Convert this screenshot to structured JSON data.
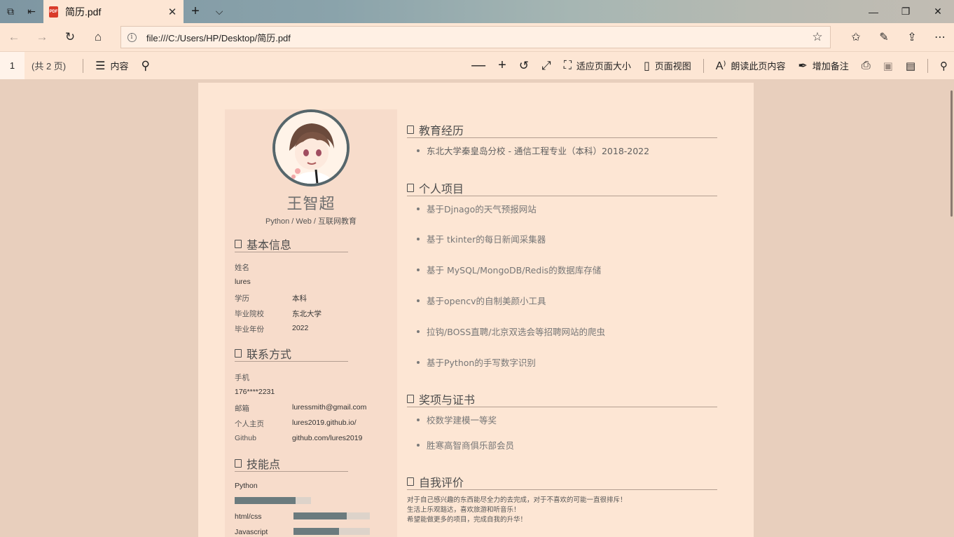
{
  "browser": {
    "tab_title": "简历.pdf",
    "tab_icon_label": "PDF",
    "address": "file:///C:/Users/HP/Desktop/简历.pdf"
  },
  "pdf_toolbar": {
    "page_current": "1",
    "page_total": "(共 2 页)",
    "contents_label": "内容",
    "fit_page_label": "适应页面大小",
    "page_view_label": "页面视图",
    "read_aloud_label": "朗读此页内容",
    "add_note_label": "增加备注"
  },
  "resume": {
    "name": "王智超",
    "subtitle": "Python / Web / 互联网教育",
    "basic_info": {
      "title": "基本信息",
      "name_label": "姓名",
      "name_value": "lures",
      "edu_label": "学历",
      "edu_value": "本科",
      "school_label": "毕业院校",
      "school_value": "东北大学",
      "year_label": "毕业年份",
      "year_value": "2022"
    },
    "contact": {
      "title": "联系方式",
      "phone_label": "手机",
      "phone_value": "176****2231",
      "email_label": "邮箱",
      "email_value": "luressmith@gmail.com",
      "homepage_label": "个人主页",
      "homepage_value": "lures2019.github.io/",
      "github_label": "Github",
      "github_value": "github.com/lures2019"
    },
    "skills": {
      "title": "技能点",
      "items": [
        {
          "name": "Python",
          "level": 0.8
        },
        {
          "name": "html/css",
          "level": 0.7
        },
        {
          "name": "Javascript",
          "level": 0.6
        }
      ]
    },
    "education": {
      "title": "教育经历",
      "items": [
        "东北大学秦皇岛分校 - 通信工程专业（本科）2018-2022"
      ]
    },
    "projects": {
      "title": "个人项目",
      "items": [
        "基于Djnago的天气预报网站",
        "基于 tkinter的每日新闻采集器",
        "基于 MySQL/MongoDB/Redis的数据库存储",
        "基于opencv的自制美颜小工具",
        "拉钩/BOSS直聘/北京双选会等招聘网站的爬虫",
        "基于Python的手写数字识别"
      ]
    },
    "awards": {
      "title": "奖项与证书",
      "items": [
        "校数学建模一等奖",
        "胜寒高智商俱乐部会员"
      ]
    },
    "self_eval": {
      "title": "自我评价",
      "lines": [
        "对于自己感兴趣的东西能尽全力的去完成，对于不喜欢的可能一直很排斥！",
        "生活上乐观豁达，喜欢旅游和听音乐！",
        "希望能做更多的项目，完成自我的升华！"
      ]
    }
  }
}
